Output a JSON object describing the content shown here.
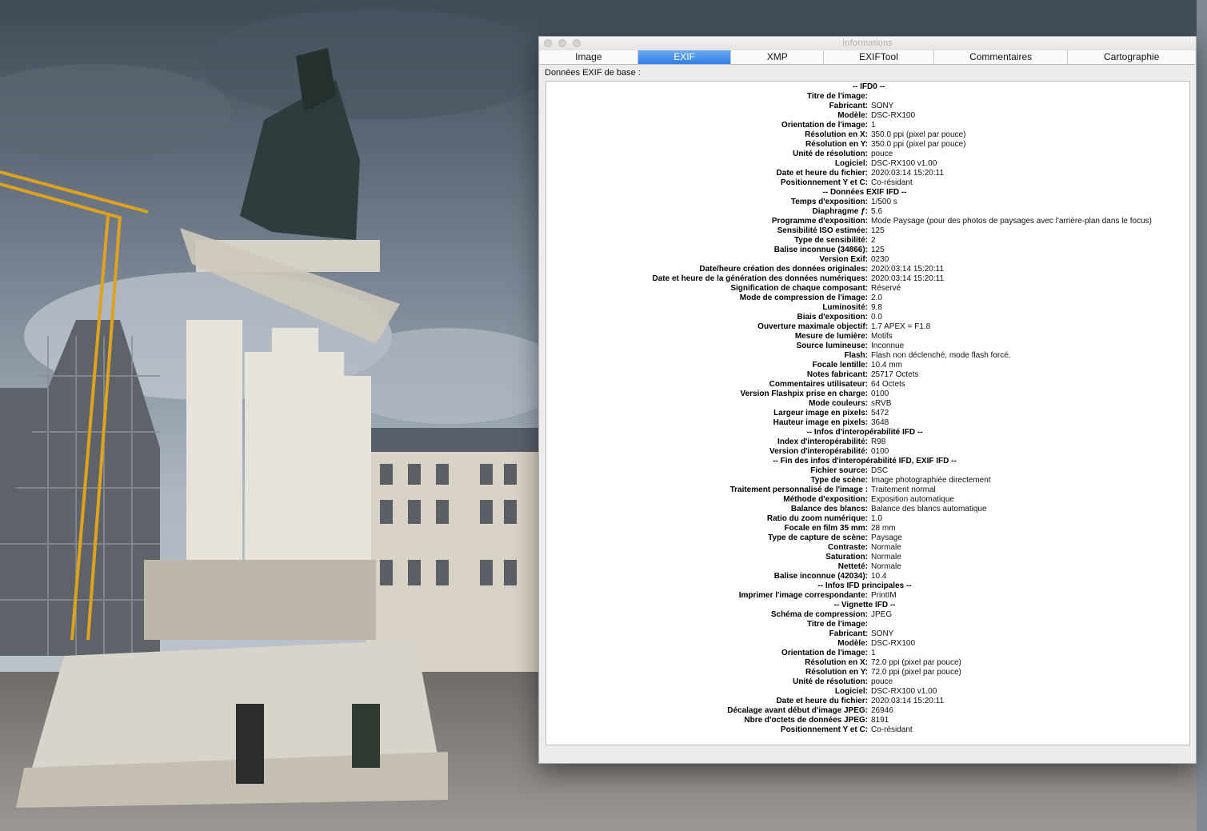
{
  "window": {
    "title": "Informations",
    "tabs": [
      {
        "label": "Image",
        "active": false
      },
      {
        "label": "EXIF",
        "active": true
      },
      {
        "label": "XMP",
        "active": false
      },
      {
        "label": "EXIFTool",
        "active": false
      },
      {
        "label": "Commentaires",
        "active": false
      },
      {
        "label": "Cartographie",
        "active": false
      }
    ],
    "section_label": "Données EXIF de base :",
    "accent_color": "#2f7ee6"
  },
  "exif": [
    {
      "header": "-- IFD0 --"
    },
    {
      "key": "Titre de l'image:",
      "value": ""
    },
    {
      "key": "Fabricant:",
      "value": "SONY"
    },
    {
      "key": "Modèle:",
      "value": "DSC-RX100"
    },
    {
      "key": "Orientation de l'image:",
      "value": "1"
    },
    {
      "key": "Résolution en X:",
      "value": "350.0 ppi (pixel par pouce)"
    },
    {
      "key": "Résolution en Y:",
      "value": "350.0 ppi (pixel par pouce)"
    },
    {
      "key": "Unité de résolution:",
      "value": "pouce"
    },
    {
      "key": "Logiciel:",
      "value": "DSC-RX100 v1.00"
    },
    {
      "key": "Date et heure du fichier:",
      "value": "2020:03:14 15:20:11"
    },
    {
      "key": "Positionnement Y et C:",
      "value": "Co-résidant"
    },
    {
      "header": "-- Données EXIF IFD --"
    },
    {
      "key": "Temps d'exposition:",
      "value": "1/500 s"
    },
    {
      "key": "Diaphragme ƒ:",
      "value": "5.6"
    },
    {
      "key": "Programme d'exposition:",
      "value": "Mode Paysage (pour des photos de paysages avec l'arrière-plan dans le focus)"
    },
    {
      "key": "Sensibilité ISO estimée:",
      "value": "125"
    },
    {
      "key": "Type de sensibilité:",
      "value": "2"
    },
    {
      "key": "Balise inconnue (34866):",
      "value": "125"
    },
    {
      "key": "Version Exif:",
      "value": "0230"
    },
    {
      "key": "Date/heure création des données originales:",
      "value": "2020:03:14 15:20:11"
    },
    {
      "key": "Date et heure de la génération des données numériques:",
      "value": "2020:03:14 15:20:11"
    },
    {
      "key": "Signification de chaque composant:",
      "value": "Réservé"
    },
    {
      "key": "Mode de compression de l'image:",
      "value": "2.0"
    },
    {
      "key": "Luminosité:",
      "value": "9.8"
    },
    {
      "key": "Biais d'exposition:",
      "value": "0.0"
    },
    {
      "key": "Ouverture maximale objectif:",
      "value": "1.7 APEX = F1.8"
    },
    {
      "key": "Mesure de lumière:",
      "value": "Motifs"
    },
    {
      "key": "Source lumineuse:",
      "value": "Inconnue"
    },
    {
      "key": "Flash:",
      "value": "Flash non déclenché, mode flash forcé."
    },
    {
      "key": "Focale lentille:",
      "value": "10.4 mm"
    },
    {
      "key": "Notes fabricant:",
      "value": "25717 Octets"
    },
    {
      "key": "Commentaires utilisateur:",
      "value": "64 Octets"
    },
    {
      "key": "Version Flashpix prise en charge:",
      "value": "0100"
    },
    {
      "key": "Mode couleurs:",
      "value": "sRVB"
    },
    {
      "key": "Largeur image en pixels:",
      "value": "5472"
    },
    {
      "key": "Hauteur image en pixels:",
      "value": "3648"
    },
    {
      "header": "-- Infos d'interopérabilité IFD --"
    },
    {
      "key": "Index d'interopérabilité:",
      "value": "R98"
    },
    {
      "key": "Version d'interopérabilité:",
      "value": "0100"
    },
    {
      "header": "-- Fin des infos d'interopérabilité IFD, EXIF IFD --"
    },
    {
      "key": "Fichier source:",
      "value": "DSC"
    },
    {
      "key": "Type de scène:",
      "value": "Image photographiée directement"
    },
    {
      "key": "Traitement personnalisé de l'image :",
      "value": "Traitement normal"
    },
    {
      "key": "Méthode d'exposition:",
      "value": "Exposition automatique"
    },
    {
      "key": "Balance des blancs:",
      "value": "Balance des blancs automatique"
    },
    {
      "key": "Ratio du zoom numérique:",
      "value": "1.0"
    },
    {
      "key": "Focale en film 35 mm:",
      "value": "28 mm"
    },
    {
      "key": "Type de capture de scène:",
      "value": "Paysage"
    },
    {
      "key": "Contraste:",
      "value": "Normale"
    },
    {
      "key": "Saturation:",
      "value": "Normale"
    },
    {
      "key": "Netteté:",
      "value": "Normale"
    },
    {
      "key": "Balise inconnue (42034):",
      "value": "10.4"
    },
    {
      "header": "-- Infos IFD principales --"
    },
    {
      "key": "Imprimer l'image correspondante:",
      "value": "PrintIM"
    },
    {
      "header": "-- Vignette IFD --"
    },
    {
      "key": "Schéma de compression:",
      "value": "JPEG"
    },
    {
      "key": "Titre de l'image:",
      "value": ""
    },
    {
      "key": "Fabricant:",
      "value": "SONY"
    },
    {
      "key": "Modèle:",
      "value": "DSC-RX100"
    },
    {
      "key": "Orientation de l'image:",
      "value": "1"
    },
    {
      "key": "Résolution en X:",
      "value": "72.0 ppi (pixel par pouce)"
    },
    {
      "key": "Résolution en Y:",
      "value": "72.0 ppi (pixel par pouce)"
    },
    {
      "key": "Unité de résolution:",
      "value": "pouce"
    },
    {
      "key": "Logiciel:",
      "value": "DSC-RX100 v1.00"
    },
    {
      "key": "Date et heure du fichier:",
      "value": "2020:03:14 15:20:11"
    },
    {
      "key": "Décalage avant début d'image JPEG:",
      "value": "26946"
    },
    {
      "key": "Nbre d'octets de données JPEG:",
      "value": "8191"
    },
    {
      "key": "Positionnement Y et C:",
      "value": "Co-résidant"
    }
  ],
  "colors": {
    "tab_active_top": "#6aa9f3",
    "tab_active_bottom": "#2f7ee6",
    "window_bg": "#ececec",
    "panel_bg": "#ffffff"
  }
}
